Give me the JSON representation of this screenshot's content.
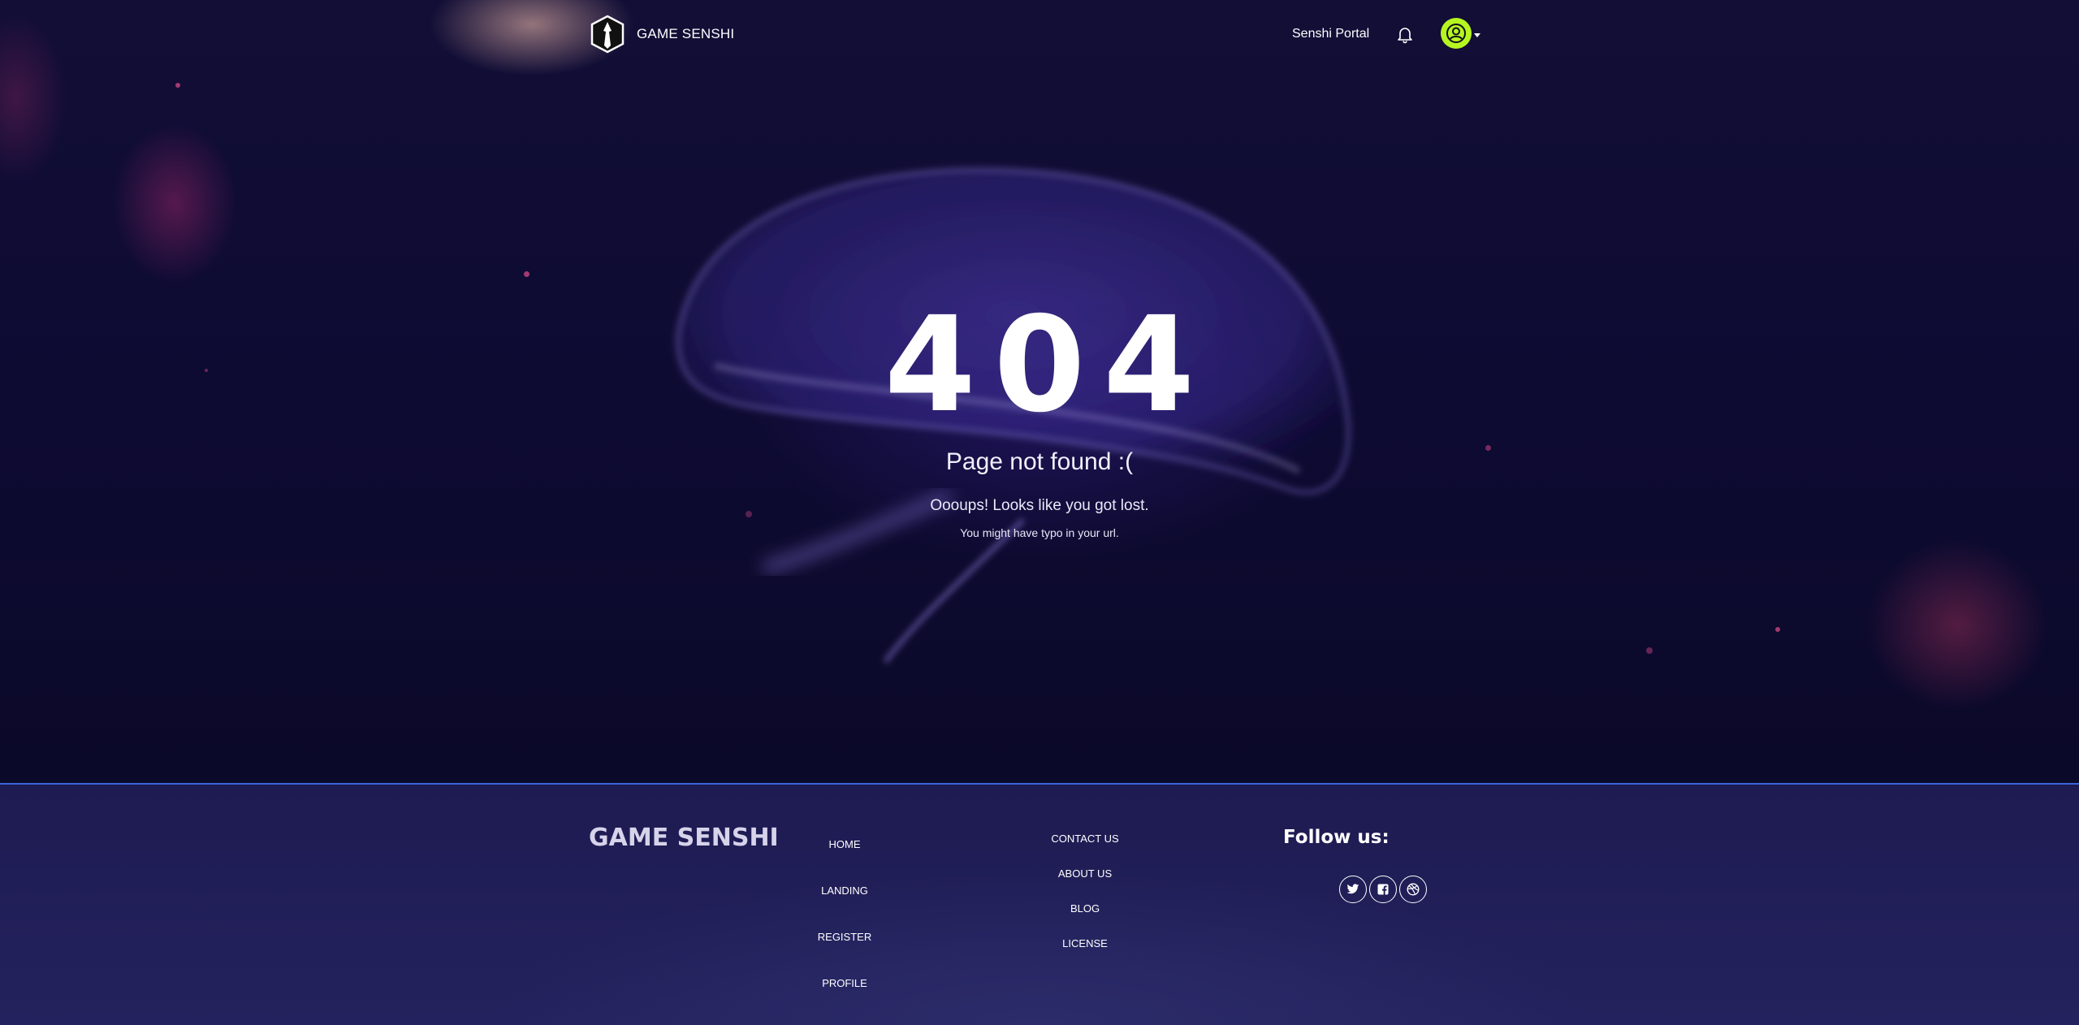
{
  "navbar": {
    "brand": "GAME SENSHI",
    "portal_link": "Senshi Portal"
  },
  "icons": {
    "logo": "senshi-logo-icon",
    "notification": "bell-icon",
    "user": "user-circle-icon",
    "dropdown": "caret-down-icon",
    "twitter": "twitter-icon",
    "facebook": "facebook-icon",
    "dribbble": "dribbble-icon"
  },
  "colors": {
    "accent": "#b6f51f",
    "footer_border": "#3a66d8"
  },
  "error": {
    "code": "404",
    "title": "Page not found :(",
    "subtitle": "Oooups! Looks like you got lost.",
    "description": "You might have typo in your url."
  },
  "footer": {
    "brand": "GAME SENSHI",
    "links_col1": [
      "HOME",
      "LANDING",
      "REGISTER",
      "PROFILE"
    ],
    "links_col2": [
      "CONTACT US",
      "ABOUT US",
      "BLOG",
      "LICENSE"
    ],
    "follow_label": "Follow us:"
  }
}
